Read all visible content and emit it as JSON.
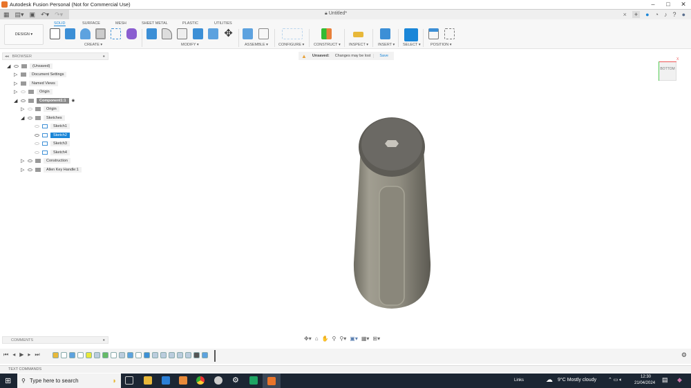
{
  "window": {
    "title": "Autodesk Fusion Personal (Not for Commercial Use)",
    "document_tab": "Untitled*",
    "close": "×",
    "minimize": "–",
    "maximize": "□",
    "win_close": "✕"
  },
  "toolbar": {
    "workspace": "DESIGN ▾",
    "tabs": [
      "SOLID",
      "SURFACE",
      "MESH",
      "SHEET METAL",
      "PLASTIC",
      "UTILITIES"
    ],
    "active_tab": "SOLID",
    "groups": [
      "CREATE ▾",
      "MODIFY ▾",
      "ASSEMBLE ▾",
      "CONFIGURE ▾",
      "CONSTRUCT ▾",
      "INSPECT ▾",
      "INSERT ▾",
      "SELECT ▾",
      "POSITION ▾"
    ]
  },
  "status": {
    "unsaved_label": "Unsaved:",
    "message": "Changes may be lost",
    "save": "Save"
  },
  "browser": {
    "title": "BROWSER",
    "items": [
      {
        "label": "(Unsaved)",
        "level": 0,
        "expanded": true
      },
      {
        "label": "Document Settings",
        "level": 1
      },
      {
        "label": "Named Views",
        "level": 1
      },
      {
        "label": "Origin",
        "level": 1
      },
      {
        "label": "Component1:1",
        "level": 1,
        "expanded": true
      },
      {
        "label": "Origin",
        "level": 2
      },
      {
        "label": "Sketches",
        "level": 2,
        "expanded": true
      },
      {
        "label": "Sketch1",
        "level": 3
      },
      {
        "label": "Sketch2",
        "level": 3,
        "selected": true
      },
      {
        "label": "Sketch3",
        "level": 3
      },
      {
        "label": "Sketch4",
        "level": 3
      },
      {
        "label": "Construction",
        "level": 2
      },
      {
        "label": "Allen Key Handle:1",
        "level": 2
      }
    ]
  },
  "viewcube": {
    "face": "BOTTOM",
    "axis_x": "X"
  },
  "comments": {
    "title": "COMMENTS"
  },
  "text_commands": {
    "title": "TEXT COMMANDS"
  },
  "taskbar": {
    "search_placeholder": "Type here to search",
    "links": "Links",
    "weather": "9°C  Mostly cloudy",
    "time": "12:30",
    "date": "21/04/2024"
  },
  "colors": {
    "accent": "#1a86d8",
    "taskbar": "#1c2633",
    "model": "#8c897c"
  }
}
